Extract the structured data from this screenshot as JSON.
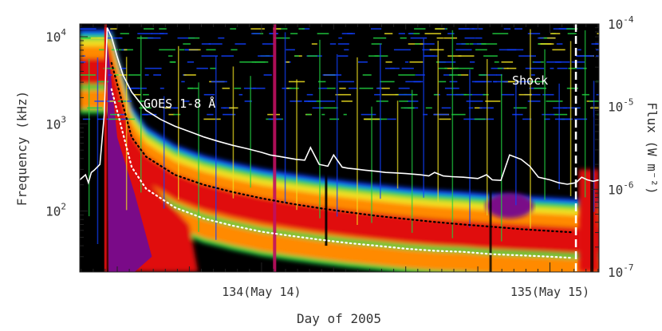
{
  "chart_data": {
    "type": "heatmap",
    "xlabel": "Day of 2005",
    "ylabel_left": "Frequency (kHz)",
    "ylabel_right": "Flux (W m⁻²)",
    "x_range_days": [
      133.37,
      135.17
    ],
    "y_left_range_khz": [
      20,
      14000
    ],
    "y_left_scale": "log",
    "y_left_ticks": [
      {
        "value": 100,
        "base": "10",
        "exp": "2"
      },
      {
        "value": 1000,
        "base": "10",
        "exp": "3"
      },
      {
        "value": 10000,
        "base": "10",
        "exp": "4"
      }
    ],
    "y_right_range_wm2": [
      1e-07,
      0.0001
    ],
    "y_right_scale": "log",
    "y_right_ticks": [
      {
        "value": 1e-07,
        "base": "10",
        "exp": "-7"
      },
      {
        "value": 1e-06,
        "base": "10",
        "exp": "-6"
      },
      {
        "value": 1e-05,
        "base": "10",
        "exp": "-5"
      },
      {
        "value": 0.0001,
        "base": "10",
        "exp": "-4"
      }
    ],
    "x_tick_labels": [
      {
        "day": 134,
        "label": "134(May 14)"
      },
      {
        "day": 135,
        "label": "135(May 15)"
      }
    ],
    "annotations": {
      "goes": "GOES 1-8 Å",
      "shock": "Shock"
    },
    "shock_day": 135.09,
    "colors": {
      "background": "#000000",
      "goes_curve": "#ffffff",
      "purple": "#7a0a88",
      "red": "#e01010",
      "orange": "#ff8a00",
      "yellow": "#f0e020",
      "green": "#20d040",
      "blue": "#1040ff"
    },
    "series": [
      {
        "kind": "goes_flux",
        "units": "W m^-2",
        "x": [
          133.37,
          133.39,
          133.4,
          133.41,
          133.42,
          133.44,
          133.455,
          133.465,
          133.48,
          133.5,
          133.52,
          133.55,
          133.6,
          133.65,
          133.7,
          133.75,
          133.8,
          133.85,
          133.9,
          133.95,
          134.0,
          134.03,
          134.06,
          134.09,
          134.12,
          134.15,
          134.17,
          134.2,
          134.23,
          134.25,
          134.28,
          134.3,
          134.33,
          134.36,
          134.4,
          134.43,
          134.46,
          134.5,
          134.55,
          134.58,
          134.6,
          134.63,
          134.66,
          134.7,
          134.75,
          134.78,
          134.8,
          134.83,
          134.86,
          134.9,
          134.93,
          134.96,
          135.0,
          135.03,
          135.06,
          135.09,
          135.11,
          135.13,
          135.15,
          135.17
        ],
        "y": [
          1.3e-06,
          1.5e-06,
          1.2e-06,
          1.6e-06,
          1.7e-06,
          2e-06,
          8e-06,
          9e-05,
          7e-05,
          4e-05,
          2.4e-05,
          1.5e-05,
          9e-06,
          7e-06,
          5.8e-06,
          5e-06,
          4.3e-06,
          3.8e-06,
          3.4e-06,
          3.1e-06,
          2.8e-06,
          2.6e-06,
          2.5e-06,
          2.4e-06,
          2.3e-06,
          2.25e-06,
          3.2e-06,
          2e-06,
          1.9e-06,
          2.6e-06,
          1.85e-06,
          1.8e-06,
          1.75e-06,
          1.7e-06,
          1.65e-06,
          1.6e-06,
          1.58e-06,
          1.55e-06,
          1.5e-06,
          1.45e-06,
          1.6e-06,
          1.45e-06,
          1.42e-06,
          1.4e-06,
          1.35e-06,
          1.5e-06,
          1.3e-06,
          1.28e-06,
          2.6e-06,
          2.3e-06,
          1.9e-06,
          1.4e-06,
          1.3e-06,
          1.2e-06,
          1.15e-06,
          1.2e-06,
          1.4e-06,
          1.3e-06,
          1.25e-06,
          1.3e-06
        ]
      },
      {
        "kind": "fit_upper",
        "units": "kHz",
        "x": [
          133.48,
          133.55,
          133.6,
          133.7,
          133.8,
          133.9,
          134.0,
          134.1,
          134.2,
          134.3,
          134.4,
          134.5,
          134.6,
          134.7,
          134.8,
          134.9,
          135.0,
          135.08
        ],
        "y": [
          5000,
          700,
          420,
          260,
          200,
          165,
          140,
          122,
          108,
          97,
          88,
          81,
          75,
          70,
          66,
          62,
          59,
          57
        ]
      },
      {
        "kind": "fit_lower",
        "units": "kHz",
        "x": [
          133.48,
          133.55,
          133.6,
          133.7,
          133.8,
          133.9,
          134.0,
          134.1,
          134.2,
          134.3,
          134.4,
          134.5,
          134.6,
          134.7,
          134.8,
          134.9,
          135.0,
          135.08
        ],
        "y": [
          2500,
          320,
          180,
          110,
          82,
          68,
          58,
          52,
          47,
          43,
          40,
          37,
          35,
          34,
          32,
          31,
          30,
          29
        ]
      }
    ]
  }
}
